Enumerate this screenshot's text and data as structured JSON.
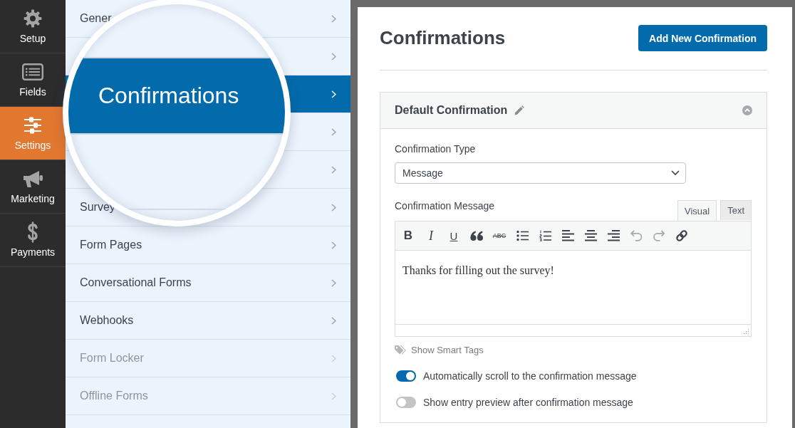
{
  "sidebar": {
    "items": [
      {
        "label": "Setup",
        "kind": "gear",
        "selected": false
      },
      {
        "label": "Fields",
        "kind": "list",
        "selected": false
      },
      {
        "label": "Settings",
        "kind": "sliders",
        "selected": true
      },
      {
        "label": "Marketing",
        "kind": "megaphone",
        "selected": false
      },
      {
        "label": "Payments",
        "kind": "dollar",
        "selected": false
      }
    ]
  },
  "settings_menu": {
    "items": [
      {
        "label": "Gener",
        "selected": false,
        "disabled": false
      },
      {
        "selected": false,
        "disabled": false
      },
      {
        "selected": true,
        "disabled": false
      },
      {
        "selected": false,
        "disabled": false
      },
      {
        "selected": false,
        "disabled": false
      },
      {
        "label": "Survey",
        "selected": false,
        "disabled": false
      },
      {
        "label": "Form Pages",
        "selected": false,
        "disabled": false
      },
      {
        "label": "Conversational Forms",
        "selected": false,
        "disabled": false
      },
      {
        "label": "Webhooks",
        "selected": false,
        "disabled": false
      },
      {
        "label": "Form Locker",
        "selected": false,
        "disabled": true
      },
      {
        "label": "Offline Forms",
        "selected": false,
        "disabled": true
      }
    ]
  },
  "magnifier": {
    "label": "Confirmations"
  },
  "header": {
    "title": "Confirmations",
    "add_button": "Add New Confirmation"
  },
  "confirmation": {
    "title": "Default Confirmation",
    "expanded": true,
    "type_label": "Confirmation Type",
    "type_value": "Message",
    "message_label": "Confirmation Message",
    "editor_tabs": [
      {
        "label": "Visual",
        "selected": true
      },
      {
        "label": "Text",
        "selected": false
      }
    ],
    "toolbar": [
      {
        "kind": "bold",
        "glyph": "B",
        "disabled": false
      },
      {
        "kind": "italic",
        "glyph": "I",
        "disabled": false
      },
      {
        "kind": "underline",
        "glyph": "U",
        "disabled": false
      },
      {
        "kind": "quote",
        "disabled": false
      },
      {
        "kind": "strikethrough",
        "glyph": "ABC",
        "disabled": false
      },
      {
        "kind": "bullets",
        "disabled": false
      },
      {
        "kind": "numbers",
        "disabled": false
      },
      {
        "kind": "alignleft",
        "disabled": false
      },
      {
        "kind": "aligncenter",
        "disabled": false
      },
      {
        "kind": "alignright",
        "disabled": false
      },
      {
        "kind": "undo",
        "disabled": true
      },
      {
        "kind": "redo",
        "disabled": true
      },
      {
        "kind": "link",
        "disabled": false
      }
    ],
    "message": "Thanks for filling out the survey!",
    "smart_tags": "Show Smart Tags",
    "toggles": [
      {
        "label": "Automatically scroll to the confirmation message",
        "on": true
      },
      {
        "label": "Show entry preview after confirmation message",
        "on": false
      }
    ]
  }
}
